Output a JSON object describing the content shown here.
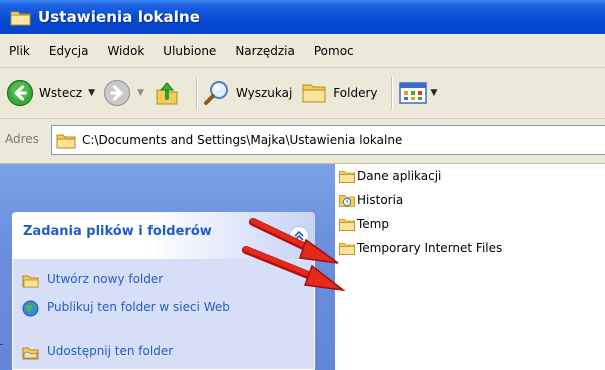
{
  "window": {
    "title": "Ustawienia lokalne"
  },
  "menu": {
    "items": [
      "Plik",
      "Edycja",
      "Widok",
      "Ulubione",
      "Narzędzia",
      "Pomoc"
    ]
  },
  "toolbar": {
    "back_label": "Wstecz",
    "search_label": "Wyszukaj",
    "folders_label": "Foldery"
  },
  "address": {
    "label": "Adres",
    "path": "C:\\Documents and Settings\\Majka\\Ustawienia lokalne"
  },
  "taskpane": {
    "header": "Zadania plików i folderów",
    "tasks": [
      {
        "label": "Utwórz nowy folder",
        "icon": "new-folder-icon"
      },
      {
        "label": "Publikuj ten folder w sieci Web",
        "icon": "publish-web-icon"
      },
      {
        "label": "Udostępnij ten folder",
        "icon": "share-folder-icon"
      }
    ]
  },
  "files": [
    {
      "name": "Dane aplikacji",
      "icon": "folder-icon"
    },
    {
      "name": "Historia",
      "icon": "history-folder-icon"
    },
    {
      "name": "Temp",
      "icon": "folder-icon"
    },
    {
      "name": "Temporary Internet Files",
      "icon": "folder-icon"
    }
  ],
  "colors": {
    "titlebar": "#0a51d8",
    "taskpane": "#6b8fde",
    "task_link": "#215dc6",
    "annotation_arrow": "#e0201a"
  }
}
